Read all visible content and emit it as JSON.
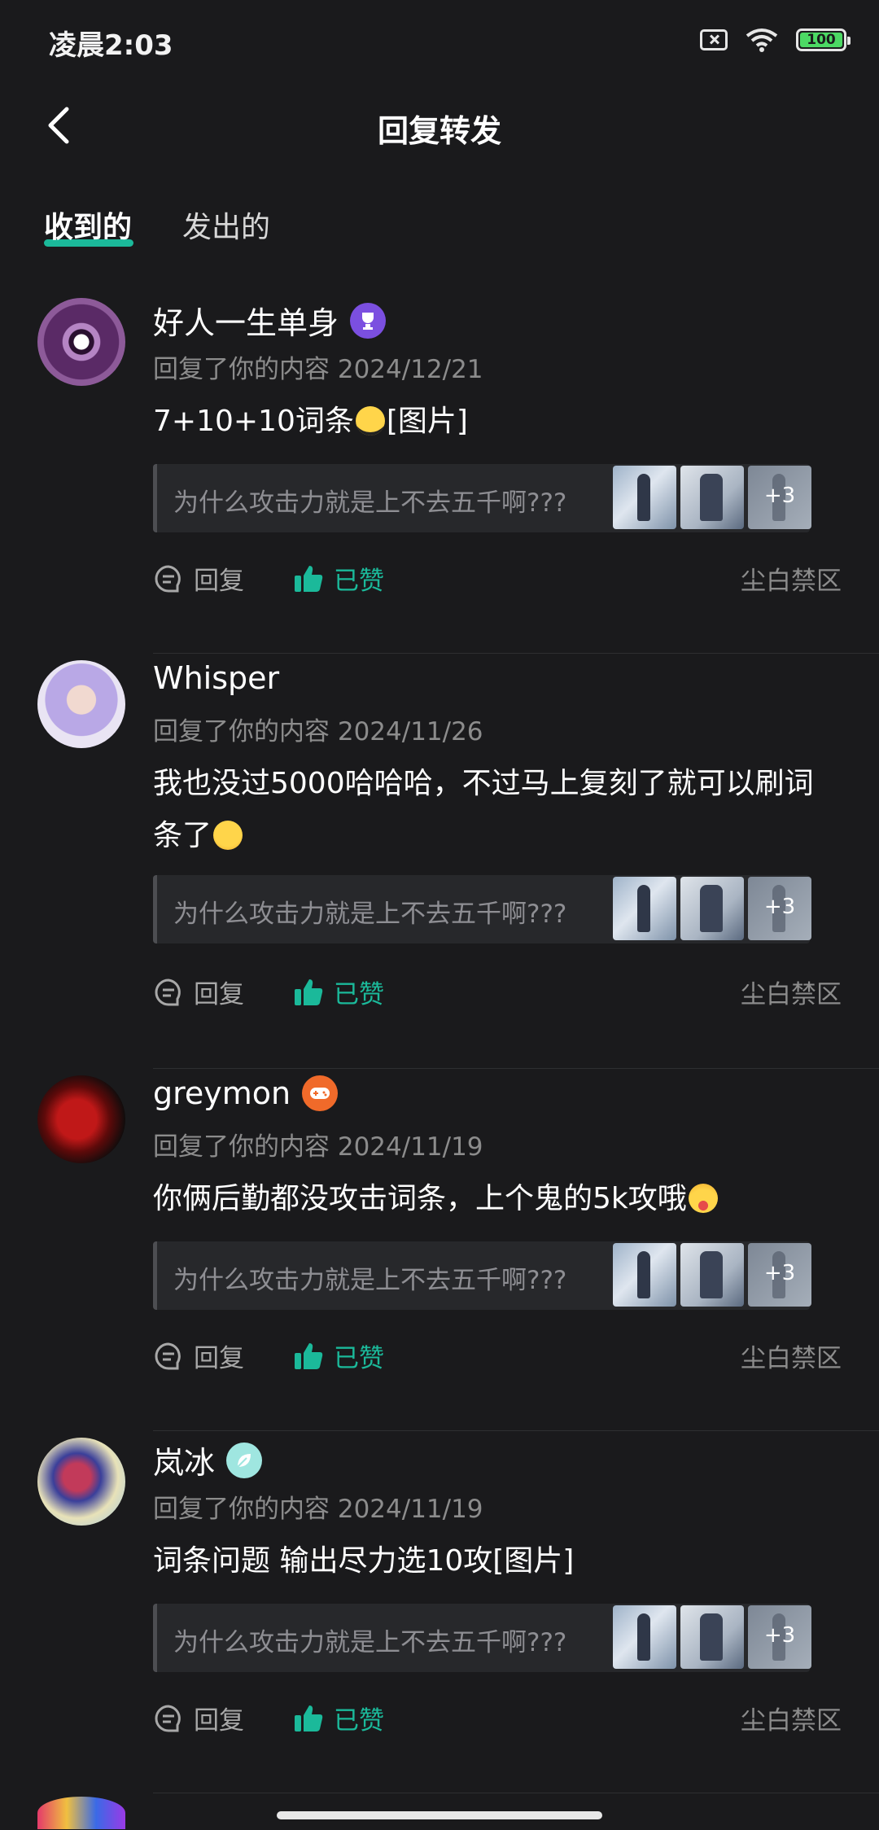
{
  "status_bar": {
    "time": "凌晨2:03",
    "battery": "100"
  },
  "nav": {
    "title": "回复转发"
  },
  "tabs": [
    {
      "label": "收到的"
    },
    {
      "label": "发出的"
    }
  ],
  "colors": {
    "accent": "#1bb99a",
    "background": "#1a1a1c",
    "card": "#27282b"
  },
  "items": [
    {
      "username": "好人一生单身",
      "badge": "trophy-badge",
      "meta": "回复了你的内容 2024/12/21",
      "content": "7+10+10词条",
      "content_emoji": "sunglasses-emoji",
      "content_suffix": "[图片]",
      "quote": "为什么攻击力就是上不去五千啊???",
      "more_images": "+3",
      "reply_label": "回复",
      "like_label": "已赞",
      "source": "尘白禁区"
    },
    {
      "username": "Whisper",
      "meta": "回复了你的内容 2024/11/26",
      "content": "我也没过5000哈哈哈，不过马上复刻了就可以刷词条了",
      "content_emoji": "kiss-emoji",
      "content_suffix": "",
      "quote": "为什么攻击力就是上不去五千啊???",
      "more_images": "+3",
      "reply_label": "回复",
      "like_label": "已赞",
      "source": "尘白禁区"
    },
    {
      "username": "greymon",
      "badge": "gamepad-badge",
      "meta": "回复了你的内容 2024/11/19",
      "content": "你俩后勤都没攻击词条，上个鬼的5k攻哦",
      "content_emoji": "tongue-emoji",
      "content_suffix": "",
      "quote": "为什么攻击力就是上不去五千啊???",
      "more_images": "+3",
      "reply_label": "回复",
      "like_label": "已赞",
      "source": "尘白禁区"
    },
    {
      "username": "岚冰",
      "badge": "leaf-badge",
      "meta": "回复了你的内容 2024/11/19",
      "content": "词条问题  输出尽力选10攻[图片]",
      "content_emoji": "",
      "content_suffix": "",
      "quote": "为什么攻击力就是上不去五千啊???",
      "more_images": "+3",
      "reply_label": "回复",
      "like_label": "已赞",
      "source": "尘白禁区"
    }
  ]
}
